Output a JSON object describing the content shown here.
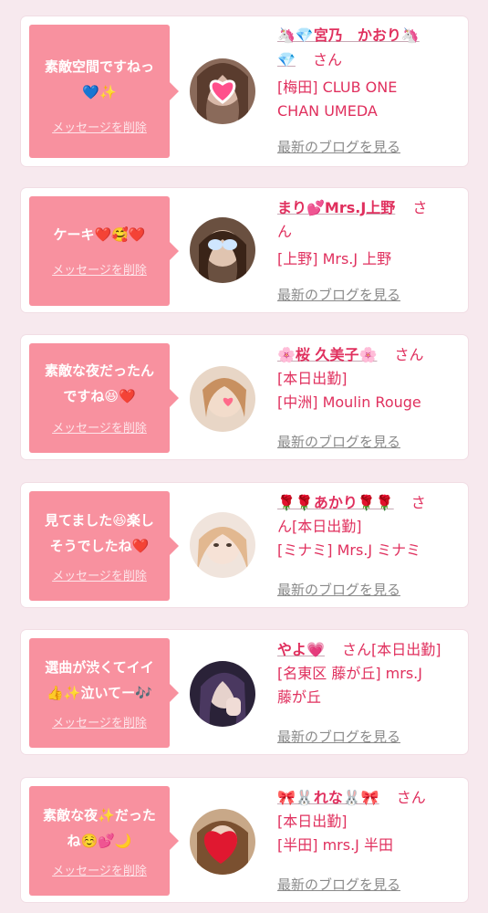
{
  "items": [
    {
      "message": [
        "素敵空間ですねっ",
        "💙✨"
      ],
      "delete_label": "メッセージを削除",
      "name": [
        "🦄💎宮乃　かおり🦄",
        "💎"
      ],
      "honorific": "さん",
      "meta": [
        "[梅田] CLUB ONE",
        "CHAN UMEDA"
      ],
      "blog_label": "最新のブログを見る",
      "avatar": "heart-sticker-photo"
    },
    {
      "message": [
        "ケーキ❤️🥰❤️"
      ],
      "delete_label": "メッセージを削除",
      "name": [
        "まり💕Mrs.J上野"
      ],
      "honorific": "さ",
      "honorific_line2": "ん",
      "meta": [
        "[上野] Mrs.J 上野"
      ],
      "blog_label": "最新のブログを見る",
      "avatar": "sparkle-eyes-photo"
    },
    {
      "message": [
        "素敵な夜だったん",
        "ですね😆❤️"
      ],
      "delete_label": "メッセージを削除",
      "name": [
        "🌸桜 久美子🌸"
      ],
      "honorific": "さん",
      "meta": [
        "[本日出勤]",
        "[中洲] Moulin Rouge"
      ],
      "blog_label": "最新のブログを見る",
      "avatar": "small-heart-photo"
    },
    {
      "message": [
        "見てました😆楽し",
        "そうでしたね❤️"
      ],
      "delete_label": "メッセージを削除",
      "name": [
        "🌹🌹あかり🌹🌹"
      ],
      "honorific": "さ",
      "honorific_line2": "ん[本日出勤]",
      "meta": [
        "[ミナミ] Mrs.J ミナミ"
      ],
      "blog_label": "最新のブログを見る",
      "avatar": "blonde-photo"
    },
    {
      "message": [
        "選曲が渋くてイイ",
        "👍✨泣いてー🎶"
      ],
      "delete_label": "メッセージを削除",
      "name": [
        "やよ💗"
      ],
      "honorific": "さん[本日出勤]",
      "meta": [
        "[名東区 藤が丘] mrs.J",
        "藤が丘"
      ],
      "blog_label": "最新のブログを見る",
      "avatar": "hand-pose-photo"
    },
    {
      "message": [
        "素敵な夜✨だった",
        "ね☺️💕🌙"
      ],
      "delete_label": "メッセージを削除",
      "name": [
        "🎀🐰れな🐰🎀"
      ],
      "honorific": "さん",
      "meta": [
        "[本日出勤]",
        "[半田] mrs.J 半田"
      ],
      "blog_label": "最新のブログを見る",
      "avatar": "big-heart-photo"
    }
  ],
  "colors": {
    "bubble": "#f8919f",
    "name_text": "#e0305e",
    "link_gray": "#8a8a8a",
    "background": "#f7e9ee"
  }
}
